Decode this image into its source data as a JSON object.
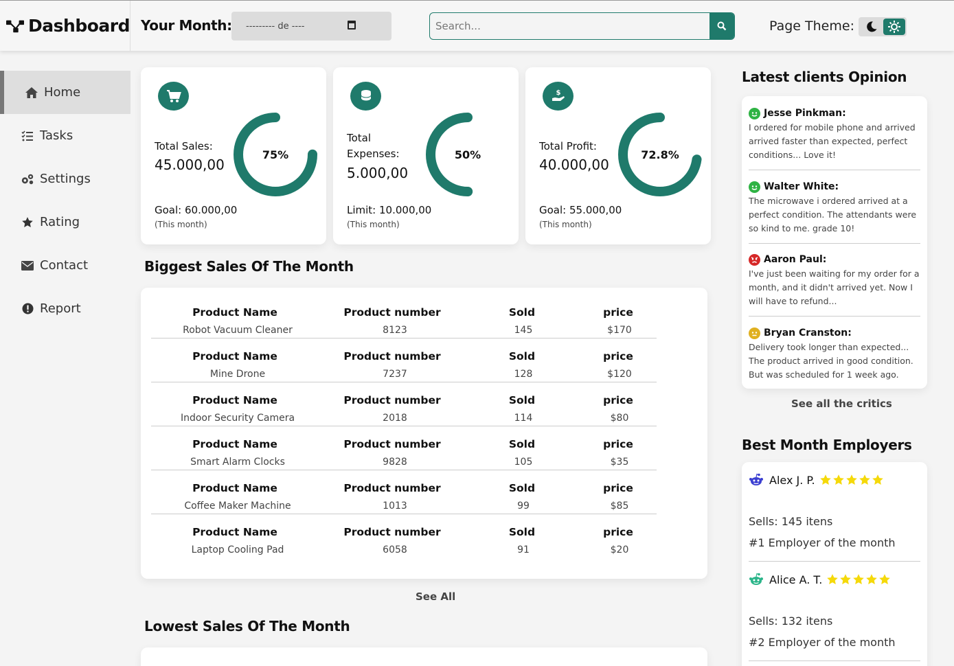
{
  "header": {
    "brand": "Dashboard",
    "month_label": "Your Month:",
    "month_value": "--------- de ----",
    "search_placeholder": "Search...",
    "theme_label": "Page Theme:"
  },
  "sidebar": {
    "items": [
      {
        "label": "Home",
        "icon": "home-icon",
        "active": true
      },
      {
        "label": "Tasks",
        "icon": "tasks-icon",
        "active": false
      },
      {
        "label": "Settings",
        "icon": "settings-icon",
        "active": false
      },
      {
        "label": "Rating",
        "icon": "star-icon",
        "active": false
      },
      {
        "label": "Contact",
        "icon": "envelope-icon",
        "active": false
      },
      {
        "label": "Report",
        "icon": "exclamation-icon",
        "active": false
      }
    ]
  },
  "stats": [
    {
      "label": "Total Sales:",
      "value": "45.000,00",
      "goal": "Goal: 60.000,00",
      "sub": "(This month)",
      "percent": 75,
      "percent_label": "75%",
      "icon": "cart-icon"
    },
    {
      "label": "Total Expenses:",
      "value": "5.000,00",
      "goal": "Limit: 10.000,00",
      "sub": "(This month)",
      "percent": 50,
      "percent_label": "50%",
      "icon": "coins-icon"
    },
    {
      "label": "Total Profit:",
      "value": "40.000,00",
      "goal": "Goal: 55.000,00",
      "sub": "(This month)",
      "percent": 72.8,
      "percent_label": "72.8%",
      "icon": "hand-dollar-icon"
    }
  ],
  "biggest_sales": {
    "title": "Biggest Sales Of The Month",
    "headers": [
      "Product Name",
      "Product number",
      "Sold",
      "price"
    ],
    "rows": [
      [
        "Robot Vacuum Cleaner",
        "8123",
        "145",
        "$170"
      ],
      [
        "Mine Drone",
        "7237",
        "128",
        "$120"
      ],
      [
        "Indoor Security Camera",
        "2018",
        "114",
        "$80"
      ],
      [
        "Smart Alarm Clocks",
        "9828",
        "105",
        "$35"
      ],
      [
        "Coffee Maker Machine",
        "1013",
        "99",
        "$85"
      ],
      [
        "Laptop Cooling Pad",
        "6058",
        "91",
        "$20"
      ]
    ],
    "see_all": "See All"
  },
  "lowest_sales": {
    "title": "Lowest Sales Of The Month"
  },
  "opinions": {
    "title": "Latest clients Opinion",
    "items": [
      {
        "name": "Jesse Pinkman:",
        "mood": "happy",
        "color": "#2fb344",
        "text": "I ordered for mobile phone and arrived arrived faster than expected, perfect conditions... Love it!"
      },
      {
        "name": "Walter White:",
        "mood": "happy",
        "color": "#2fb344",
        "text": "The microwave i ordered arrived at a perfect condition. The attendants were so kind to me. grade 10!"
      },
      {
        "name": "Aaron Paul:",
        "mood": "angry",
        "color": "#d62828",
        "text": "I've just been waiting for my order for a month, and it didn't arrived yet. Now I will have to refund..."
      },
      {
        "name": "Bryan Cranston:",
        "mood": "neutral",
        "color": "#e0b020",
        "text": "Delivery took longer than expected... The product arrived in good condition. But was scheduled for 1 week ago."
      }
    ],
    "see_all": "See all the critics"
  },
  "employers": {
    "title": "Best Month Employers",
    "items": [
      {
        "name": "Alex J. P.",
        "rating": 5,
        "sells": "Sells: 145 itens",
        "rank": "#1 Employer of the month",
        "icon": "reddit-alien-icon",
        "color": "#3b3fd1"
      },
      {
        "name": "Alice A. T.",
        "rating": 5,
        "sells": "Sells: 132 itens",
        "rank": "#2 Employer of the month",
        "icon": "reddit-alien-icon",
        "color": "#2bb58a"
      }
    ]
  },
  "colors": {
    "accent": "#1f7a6b",
    "star": "#f5d90a"
  }
}
